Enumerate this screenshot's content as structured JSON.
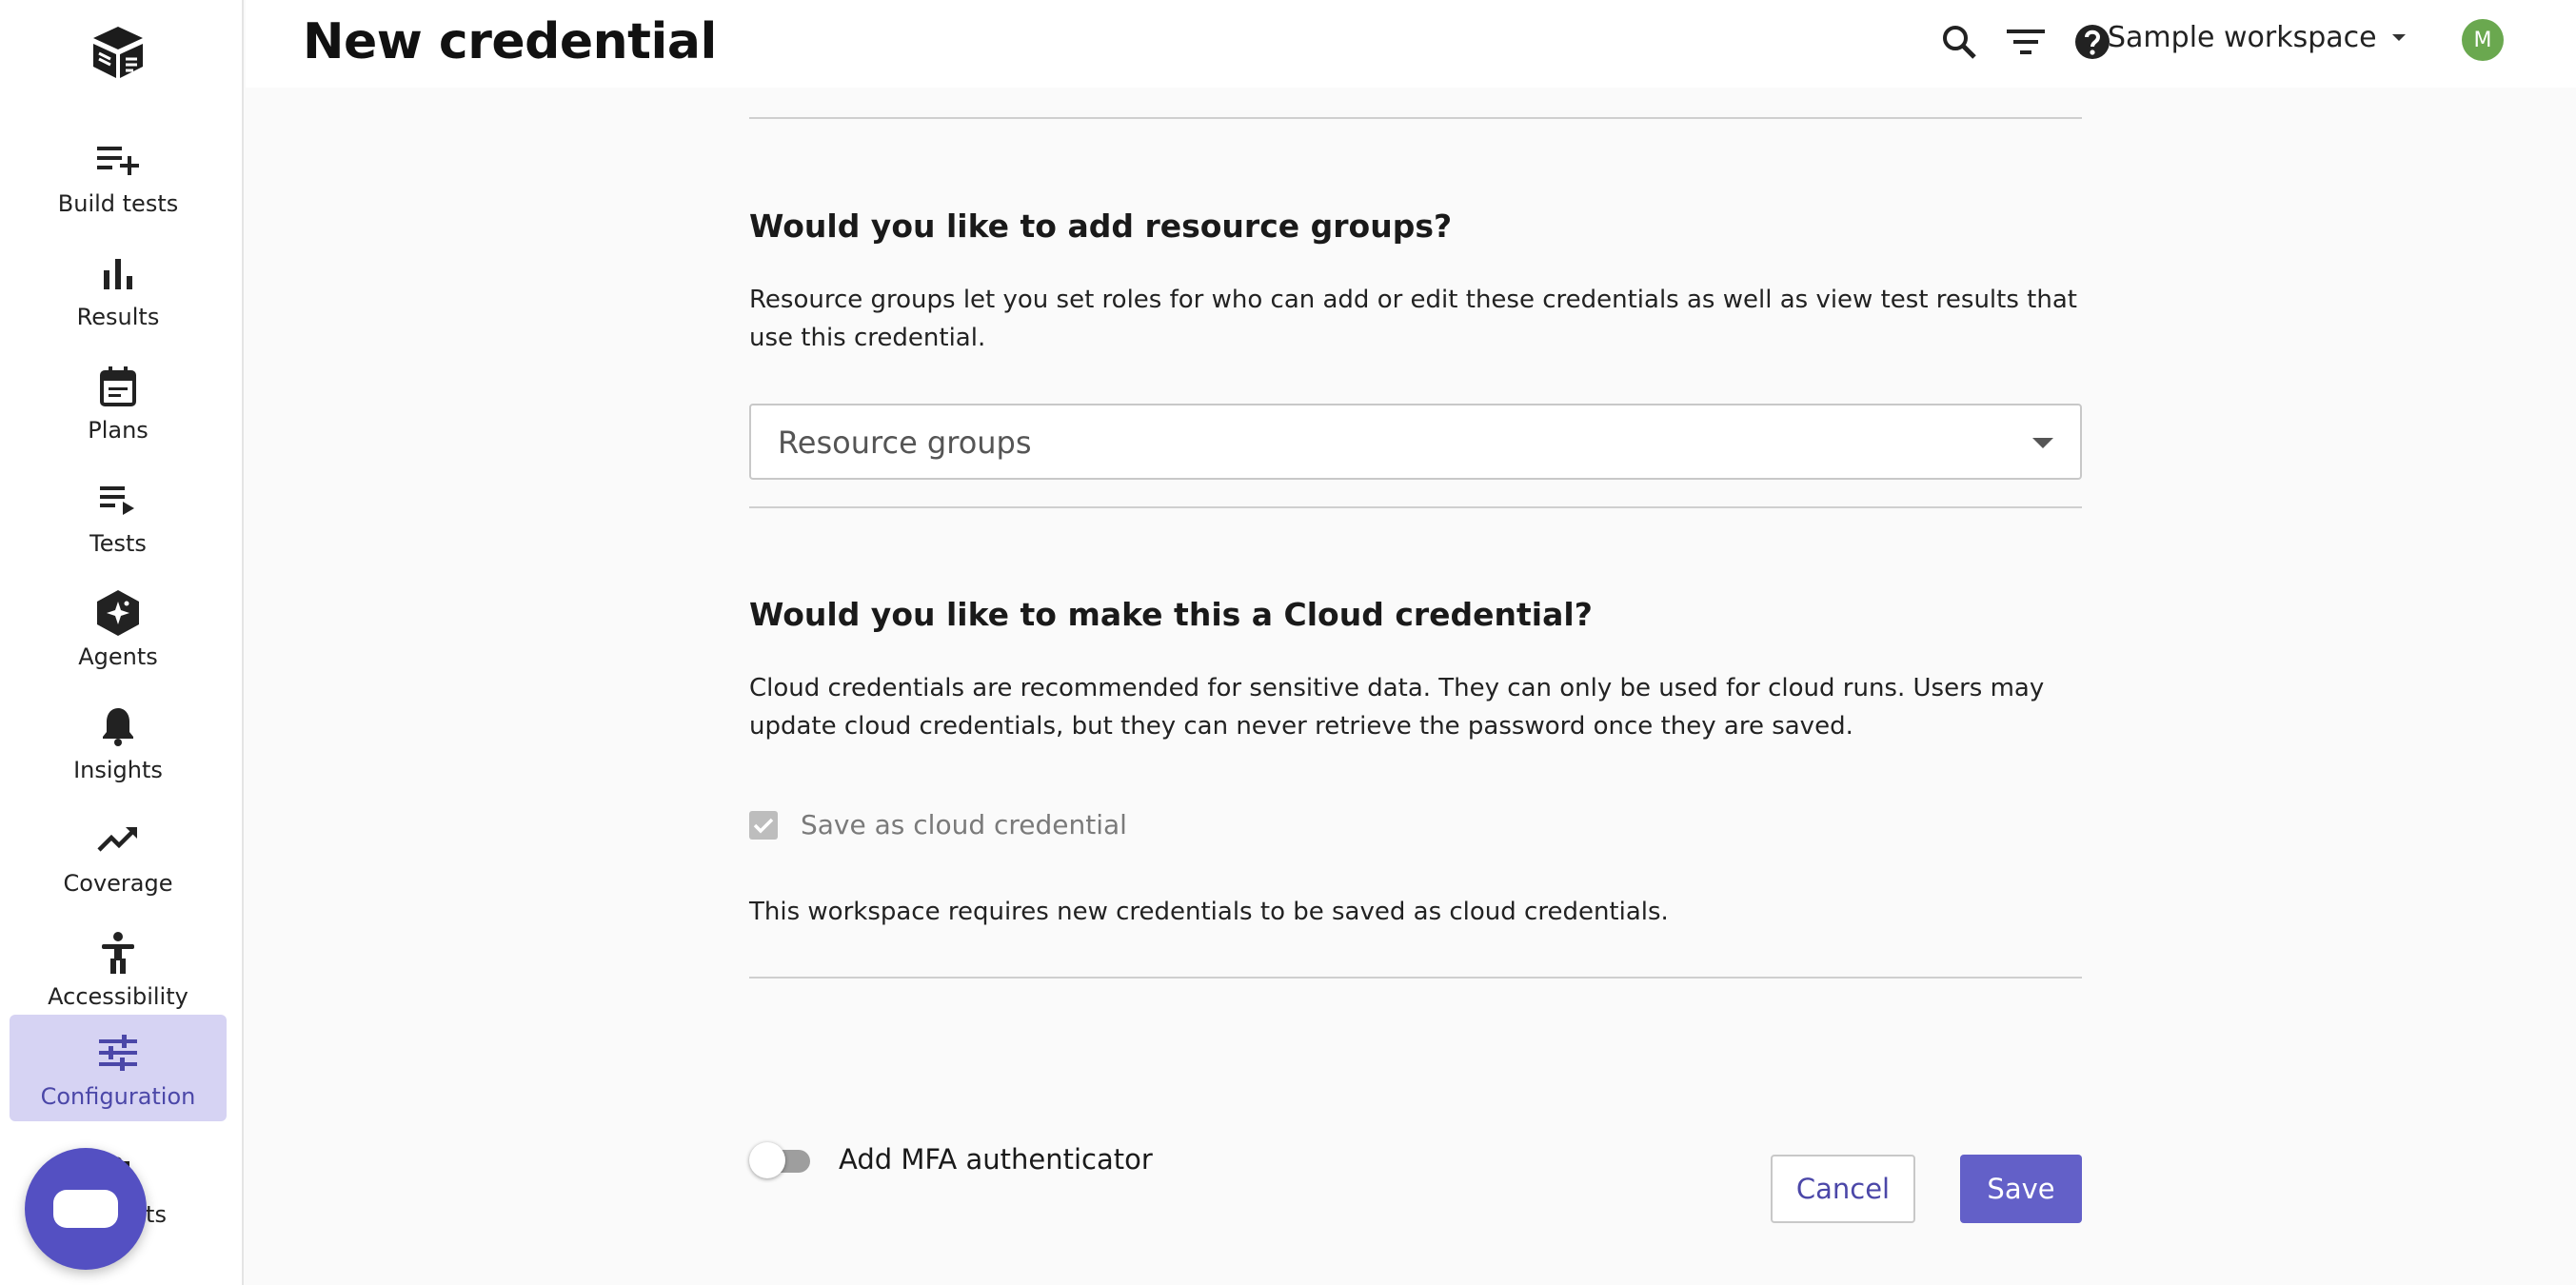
{
  "header": {
    "title": "New credential",
    "workspace": "Sample workspace",
    "avatar_initial": "M",
    "icons": [
      "search-icon",
      "filter-icon",
      "help-icon"
    ]
  },
  "sidebar": {
    "items": [
      {
        "label": "Build tests",
        "icon": "playlist-add-icon"
      },
      {
        "label": "Results",
        "icon": "bar-chart-icon"
      },
      {
        "label": "Plans",
        "icon": "calendar-icon"
      },
      {
        "label": "Tests",
        "icon": "playlist-play-icon"
      },
      {
        "label": "Agents",
        "icon": "agent-sparkle-icon"
      },
      {
        "label": "Insights",
        "icon": "bell-icon"
      },
      {
        "label": "Coverage",
        "icon": "trending-up-icon"
      },
      {
        "label": "Accessibility",
        "icon": "accessibility-icon"
      },
      {
        "label": "Configuration",
        "icon": "tune-icon",
        "active": true
      },
      {
        "label": "ts",
        "icon": "extension-icon"
      }
    ],
    "accent_color": "#d6d3f3"
  },
  "resource_groups": {
    "title": "Would you like to add resource groups?",
    "description": "Resource groups let you set roles for who can add or edit these credentials as well as view test results that use this credential.",
    "select_placeholder": "Resource groups"
  },
  "cloud": {
    "title": "Would you like to make this a Cloud credential?",
    "description": "Cloud credentials are recommended for sensitive data. They can only be used for cloud runs. Users may update cloud credentials, but they can never retrieve the password once they are saved.",
    "checkbox_label": "Save as cloud credential",
    "checkbox_checked": true,
    "checkbox_disabled": true,
    "note": "This workspace requires new credentials to be saved as cloud credentials."
  },
  "mfa": {
    "label": "Add MFA authenticator",
    "enabled": false
  },
  "actions": {
    "cancel_label": "Cancel",
    "save_label": "Save",
    "primary_color": "#6360c8"
  }
}
